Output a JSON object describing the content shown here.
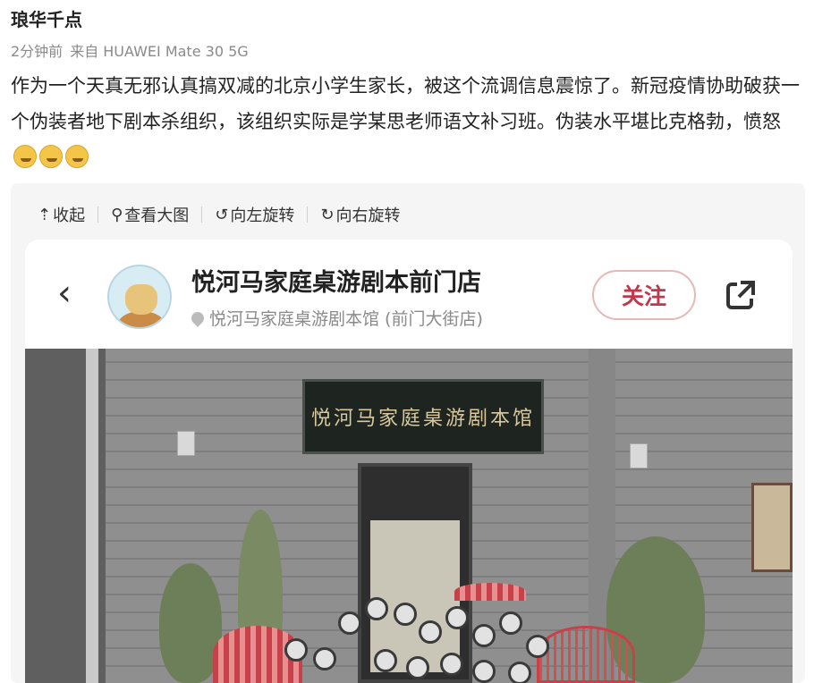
{
  "post": {
    "author": "琅华千点",
    "time": "2分钟前",
    "source": "来自 HUAWEI Mate 30 5G",
    "text": "作为一个天真无邪认真搞双减的北京小学生家长，被这个流调信息震惊了。新冠疫情协助破获一个伪装者地下剧本杀组织，该组织实际是学某思老师语文补习班。伪装水平堪比克格勃，愤怒"
  },
  "toolbar": {
    "collapse": "收起",
    "view_large": "查看大图",
    "rotate_left": "向左旋转",
    "rotate_right": "向右旋转"
  },
  "card": {
    "shop_name": "悦河马家庭桌游剧本前门店",
    "location": "悦河马家庭桌游剧本馆 (前门大街店)",
    "follow_label": "关注"
  },
  "photo": {
    "sign_text": "悦河马家庭桌游剧本馆"
  },
  "icons": {
    "back": "chevron-left-icon",
    "share": "share-out-icon",
    "location": "pin-icon"
  },
  "colors": {
    "follow_accent": "#c0394b",
    "muted_text": "#8a8a8a"
  }
}
